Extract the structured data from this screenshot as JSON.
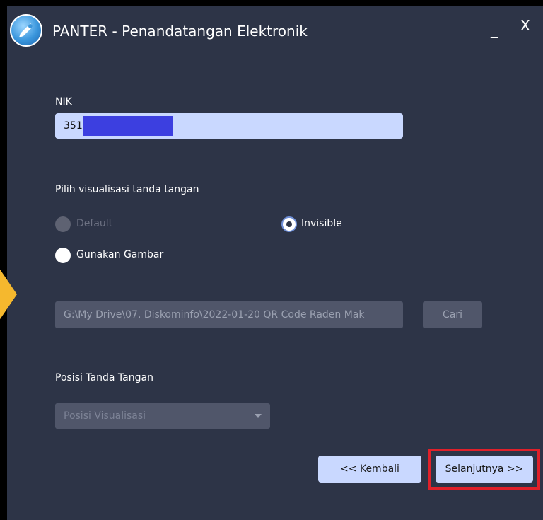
{
  "window": {
    "title": "PANTER - Penandatangan Elektronik",
    "minimize_label": "_",
    "close_label": "X"
  },
  "nik": {
    "label": "NIK",
    "value": "351"
  },
  "visualization": {
    "label": "Pilih visualisasi tanda tangan",
    "options": [
      {
        "label": "Default",
        "state": "disabled"
      },
      {
        "label": "Invisible",
        "state": "checked"
      },
      {
        "label": "Gunakan Gambar",
        "state": "unchecked"
      }
    ]
  },
  "image_path": {
    "value": "G:\\My Drive\\07. Diskominfo\\2022-01-20 QR Code Raden Mak",
    "browse_label": "Cari"
  },
  "position": {
    "label": "Posisi Tanda Tangan",
    "placeholder": "Posisi Visualisasi"
  },
  "footer": {
    "back_label": "<< Kembali",
    "next_label": "Selanjutnya >>"
  },
  "colors": {
    "window_bg": "#2d3447",
    "field_bg": "#c9d8ff",
    "disabled_bg": "#50566a",
    "highlight": "#e0202a",
    "arrow": "#f5b82e",
    "redaction": "#3c3fe0"
  },
  "icons": {
    "app_logo": "panter-pen-logo-icon",
    "dropdown": "chevron-down-icon"
  }
}
